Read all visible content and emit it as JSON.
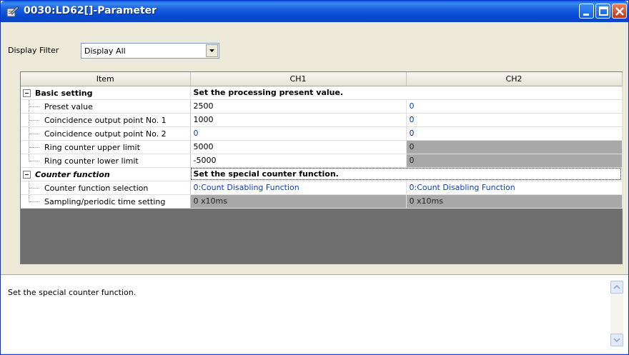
{
  "window": {
    "title": "0030:LD62[]-Parameter",
    "icon": "parameter-icon"
  },
  "filter": {
    "label": "Display Filter",
    "selected": "Display All"
  },
  "grid": {
    "headers": [
      "Item",
      "CH1",
      "CH2"
    ],
    "groups": [
      {
        "label": "Basic setting",
        "description": "Set the processing present value.",
        "rows": [
          {
            "label": "Preset value",
            "ch1": "2500",
            "ch2": "0",
            "ch1_style": "normal",
            "ch2_style": "blue"
          },
          {
            "label": "Coincidence output point No. 1",
            "ch1": "1000",
            "ch2": "0",
            "ch1_style": "normal",
            "ch2_style": "blue"
          },
          {
            "label": "Coincidence output point No. 2",
            "ch1": "0",
            "ch2": "0",
            "ch1_style": "blue",
            "ch2_style": "blue"
          },
          {
            "label": "Ring counter upper limit",
            "ch1": "5000",
            "ch2": "0",
            "ch1_style": "normal",
            "ch2_style": "gray"
          },
          {
            "label": "Ring counter lower limit",
            "ch1": "-5000",
            "ch2": "0",
            "ch1_style": "normal",
            "ch2_style": "gray"
          }
        ]
      },
      {
        "label": "Counter function",
        "description": "Set the special counter function.",
        "rows": [
          {
            "label": "Counter function selection",
            "ch1": "0:Count Disabling Function",
            "ch2": "0:Count Disabling Function",
            "ch1_style": "blue",
            "ch2_style": "blue"
          },
          {
            "label": "Sampling/periodic time setting",
            "ch1": "0 x10ms",
            "ch2": "0 x10ms",
            "ch1_style": "gray",
            "ch2_style": "gray"
          }
        ]
      }
    ]
  },
  "description_panel": {
    "text": "Set the special counter function."
  },
  "colors": {
    "titlebar": "#0a5ce3",
    "value_blue": "#0b3fb8",
    "disabled_gray": "#a8a8a8"
  }
}
